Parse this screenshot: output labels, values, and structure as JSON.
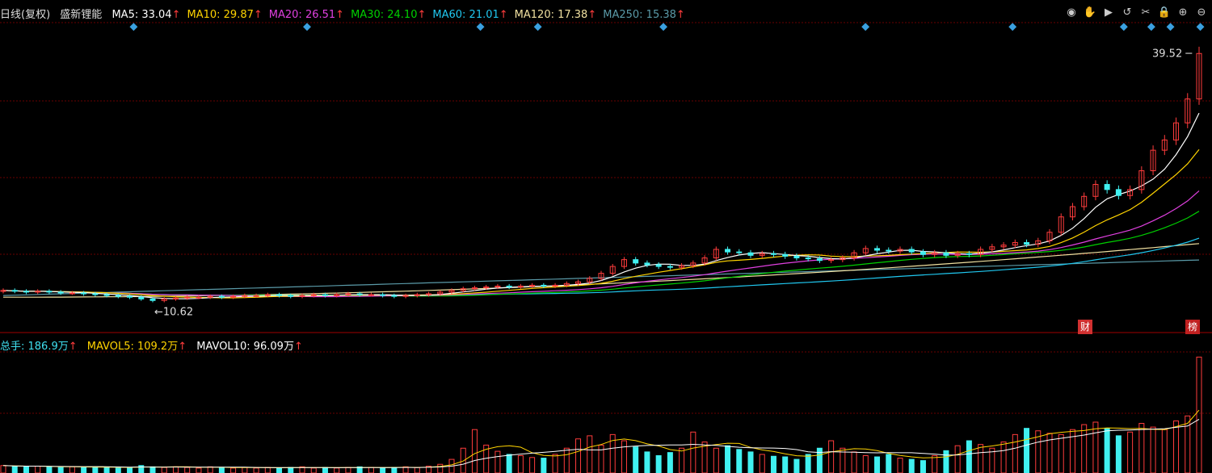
{
  "header": {
    "period": "日线(复权)",
    "stock_name": "盛新锂能",
    "mas": [
      {
        "label": "MA5: ",
        "value": "33.04",
        "color": "#ffffff"
      },
      {
        "label": "MA10: ",
        "value": "29.87",
        "color": "#ffd400"
      },
      {
        "label": "MA20: ",
        "value": "26.51",
        "color": "#e040e0"
      },
      {
        "label": "MA30: ",
        "value": "24.10",
        "color": "#00d000"
      },
      {
        "label": "MA60: ",
        "value": "21.01",
        "color": "#20c8f0"
      },
      {
        "label": "MA120: ",
        "value": "17.38",
        "color": "#f0e0a0"
      },
      {
        "label": "MA250: ",
        "value": "15.38",
        "color": "#5a9aa8"
      }
    ],
    "up_arrow": "↑"
  },
  "toolbar_icons": [
    "eye-icon",
    "hand-icon",
    "play-icon",
    "undo-icon",
    "scissors-icon",
    "lock-icon",
    "zoom-in-icon",
    "zoom-out-icon"
  ],
  "price_labels": {
    "high": "39.52",
    "low": "10.62"
  },
  "tags": [
    {
      "text": "财",
      "color": "#d03030"
    },
    {
      "text": "榜",
      "color": "#c02020"
    }
  ],
  "volume_legend": {
    "total_label": "总手: ",
    "total_value": "186.9万",
    "total_color": "#40e0f0",
    "mavol5_label": "MAVOL5: ",
    "mavol5_value": "109.2万",
    "mavol5_color": "#ffd400",
    "mavol10_label": "MAVOL10: ",
    "mavol10_value": "96.09万",
    "mavol10_color": "#ffffff"
  },
  "chart_data": {
    "type": "candlestick",
    "price_range": [
      8,
      42
    ],
    "closes": [
      11.8,
      11.7,
      11.6,
      11.7,
      11.6,
      11.5,
      11.5,
      11.4,
      11.3,
      11.2,
      11.1,
      11.0,
      10.8,
      10.62,
      10.8,
      10.9,
      11.0,
      11.0,
      11.1,
      11.0,
      11.1,
      11.2,
      11.2,
      11.3,
      11.2,
      11.1,
      11.2,
      11.3,
      11.2,
      11.3,
      11.4,
      11.3,
      11.3,
      11.2,
      11.1,
      11.2,
      11.3,
      11.4,
      11.6,
      11.8,
      12.0,
      12.1,
      12.2,
      12.3,
      12.2,
      12.3,
      12.4,
      12.3,
      12.4,
      12.6,
      12.8,
      13.2,
      13.8,
      14.6,
      15.4,
      15.0,
      14.8,
      14.6,
      14.5,
      14.7,
      15.0,
      15.6,
      16.6,
      16.3,
      16.2,
      15.9,
      16.1,
      16.0,
      15.8,
      15.6,
      15.5,
      15.3,
      15.4,
      15.6,
      16.2,
      16.7,
      16.5,
      16.4,
      16.6,
      16.3,
      16.0,
      16.2,
      15.9,
      16.1,
      16.0,
      16.6,
      16.9,
      17.1,
      17.4,
      17.2,
      17.6,
      18.6,
      20.4,
      21.6,
      22.8,
      24.2,
      23.6,
      22.9,
      23.6,
      25.8,
      28.2,
      29.4,
      31.4,
      34.2,
      39.52
    ],
    "volumes": [
      12,
      11,
      10,
      11,
      10,
      9,
      10,
      9,
      10,
      9,
      8,
      9,
      12,
      10,
      9,
      10,
      9,
      8,
      10,
      9,
      8,
      9,
      8,
      9,
      8,
      9,
      10,
      8,
      9,
      8,
      9,
      10,
      9,
      8,
      9,
      10,
      9,
      11,
      14,
      22,
      40,
      70,
      45,
      35,
      30,
      28,
      25,
      24,
      30,
      40,
      55,
      60,
      45,
      62,
      52,
      42,
      34,
      28,
      33,
      40,
      66,
      50,
      40,
      44,
      38,
      34,
      30,
      27,
      26,
      22,
      30,
      40,
      52,
      40,
      34,
      28,
      26,
      30,
      24,
      22,
      20,
      28,
      36,
      44,
      52,
      46,
      40,
      50,
      62,
      72,
      68,
      64,
      62,
      70,
      78,
      82,
      72,
      60,
      66,
      80,
      74,
      70,
      84,
      92,
      186.9
    ],
    "n_days": 135
  }
}
